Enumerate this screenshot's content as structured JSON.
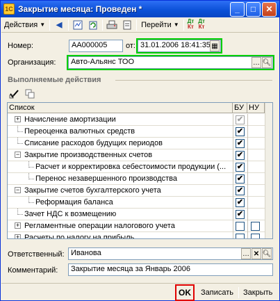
{
  "window": {
    "title": "Закрытие месяца: Проведен *",
    "app_icon": "1c-document-icon"
  },
  "toolbar": {
    "actions_label": "Действия",
    "goto_label": "Перейти",
    "dt_label": "Дт",
    "kt_label": "Кт"
  },
  "form": {
    "number_label": "Номер:",
    "number_value": "АА000005",
    "from_label": "от:",
    "date_value": "31.01.2006 18:41:35",
    "org_label": "Организация:",
    "org_value": "Авто-Альянс ТОО",
    "section_title": "Выполняемые действия",
    "responsible_label": "Ответственный:",
    "responsible_value": "Иванова",
    "comment_label": "Комментарий:",
    "comment_value": "Закрытие месяца за Январь 2006"
  },
  "grid": {
    "columns": [
      "Список",
      "БУ",
      "НУ"
    ],
    "rows": [
      {
        "label": "Начисление амортизации",
        "level": 0,
        "expander": "+",
        "bu": true,
        "bu_gray": true,
        "nu": null
      },
      {
        "label": "Переоценка валютных средств",
        "level": 0,
        "expander": "",
        "bu": true,
        "bu_gray": false,
        "nu": null
      },
      {
        "label": "Списание расходов будущих периодов",
        "level": 0,
        "expander": "",
        "bu": true,
        "bu_gray": false,
        "nu": null
      },
      {
        "label": "Закрытие производственных счетов",
        "level": 0,
        "expander": "−",
        "bu": true,
        "bu_gray": false,
        "nu": null
      },
      {
        "label": "Расчет и корректировка себестоимости продукции (...",
        "level": 1,
        "expander": "",
        "bu": true,
        "bu_gray": false,
        "nu": null
      },
      {
        "label": "Перенос незавершенного производства",
        "level": 1,
        "expander": "",
        "bu": true,
        "bu_gray": false,
        "nu": null
      },
      {
        "label": "Закрытие счетов бухгалтерского учета",
        "level": 0,
        "expander": "−",
        "bu": true,
        "bu_gray": false,
        "nu": null
      },
      {
        "label": "Реформация баланса",
        "level": 1,
        "expander": "",
        "bu": true,
        "bu_gray": false,
        "nu": null
      },
      {
        "label": "Зачет НДС к возмещению",
        "level": 0,
        "expander": "",
        "bu": true,
        "bu_gray": false,
        "nu": null
      },
      {
        "label": "Регламентные операции налогового учета",
        "level": 0,
        "expander": "+",
        "bu": false,
        "bu_gray": false,
        "nu": false
      },
      {
        "label": "Расчеты по налогу на прибыль",
        "level": 0,
        "expander": "+",
        "bu": false,
        "bu_gray": false,
        "nu": false
      }
    ]
  },
  "footer": {
    "ok_label": "OK",
    "save_label": "Записать",
    "close_label": "Закрыть"
  }
}
